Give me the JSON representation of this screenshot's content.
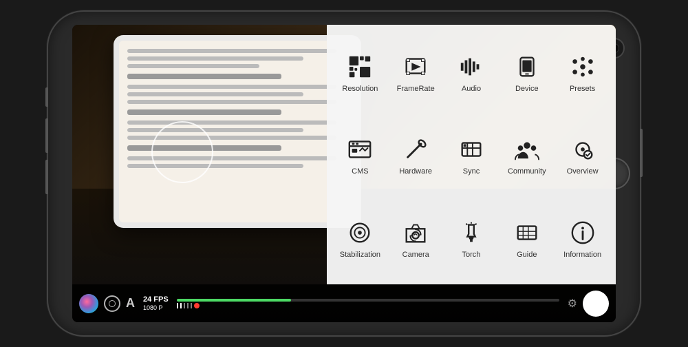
{
  "phone": {
    "title": "iPhone camera app with menu overlay"
  },
  "bottom_bar": {
    "fps": "24 FPS",
    "resolution": "1080 P"
  },
  "menu": {
    "items": [
      {
        "id": "resolution",
        "label": "Resolution",
        "icon": "resolution"
      },
      {
        "id": "framerate",
        "label": "FrameRate",
        "icon": "framerate"
      },
      {
        "id": "audio",
        "label": "Audio",
        "icon": "audio"
      },
      {
        "id": "device",
        "label": "Device",
        "icon": "device"
      },
      {
        "id": "presets",
        "label": "Presets",
        "icon": "presets"
      },
      {
        "id": "cms",
        "label": "CMS",
        "icon": "cms"
      },
      {
        "id": "hardware",
        "label": "Hardware",
        "icon": "hardware"
      },
      {
        "id": "sync",
        "label": "Sync",
        "icon": "sync"
      },
      {
        "id": "community",
        "label": "Community",
        "icon": "community"
      },
      {
        "id": "overview",
        "label": "Overview",
        "icon": "overview"
      },
      {
        "id": "stabilization",
        "label": "Stabilization",
        "icon": "stabilization"
      },
      {
        "id": "camera",
        "label": "Camera",
        "icon": "camera"
      },
      {
        "id": "torch",
        "label": "Torch",
        "icon": "torch"
      },
      {
        "id": "guide",
        "label": "Guide",
        "icon": "guide"
      },
      {
        "id": "information",
        "label": "Information",
        "icon": "information"
      }
    ]
  }
}
